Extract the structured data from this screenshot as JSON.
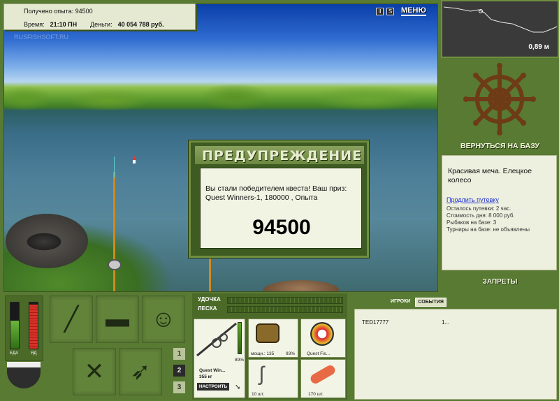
{
  "top_info": {
    "experience_label": "Получено опыта:",
    "experience_value": "94500",
    "time_label": "Время:",
    "time_value": "21:10 ПН",
    "money_label": "Деньги:",
    "money_value": "40 054 788 руб."
  },
  "top_buttons": {
    "pause": "II",
    "sound": "S",
    "menu": "МЕНЮ"
  },
  "watermark": "RUSFISHSOFT.RU",
  "dialog": {
    "title": "ПРЕДУПРЕЖДЕНИЕ",
    "message": "Вы стали победителем квеста! Ваш приз: Quest Winners-1, 180000 , Опыта",
    "number": "94500"
  },
  "minimap": {
    "depth": "0,89 м"
  },
  "right_panel": {
    "return_button": "ВЕРНУТЬСЯ НА БАЗУ",
    "base_name": "Красивая меча. Елецкое колесо",
    "extend_link": "Продлить путевку",
    "lines": [
      "Осталось путевки: 2 час.",
      "Стоимость дня: 8 000 руб.",
      "Рыбаков на базе: 3",
      "Турниры на базе: не объявлены"
    ],
    "bans_button": "ЗАПРЕТЫ"
  },
  "meters": {
    "food_label": "ЕДА",
    "energy_label": "ЯД",
    "food_level": 0.6,
    "energy_level": 0.95
  },
  "inventory": {
    "rod_icon": "fishing-rod-icon",
    "tackle_box_icon": "tackle-box-icon",
    "fisherman_icon": "fisherman-icon",
    "food_icon": "fork-knife-icon",
    "fish_icon": "fish-icon",
    "pages": [
      "1",
      "2",
      "3"
    ],
    "active_page": "2"
  },
  "tackle": {
    "rod_label": "УДОЧКА",
    "line_label": "ЛЕСКА",
    "rod_name": "Quest Win...",
    "rod_weight": "355 кг",
    "rod_percent": "89%",
    "reel_power": "мощн.: 135",
    "reel_percent": "93%",
    "line_name": "Quest Fis...",
    "hooks_count": "10 шт.",
    "bait_count": "170 шт.",
    "configure_button": "НАСТРОИТЬ"
  },
  "players_panel": {
    "tab_players": "ИГРОКИ",
    "tab_events": "СОБЫТИЯ",
    "rows": [
      {
        "name": "TED17777",
        "value": "1..."
      }
    ]
  }
}
